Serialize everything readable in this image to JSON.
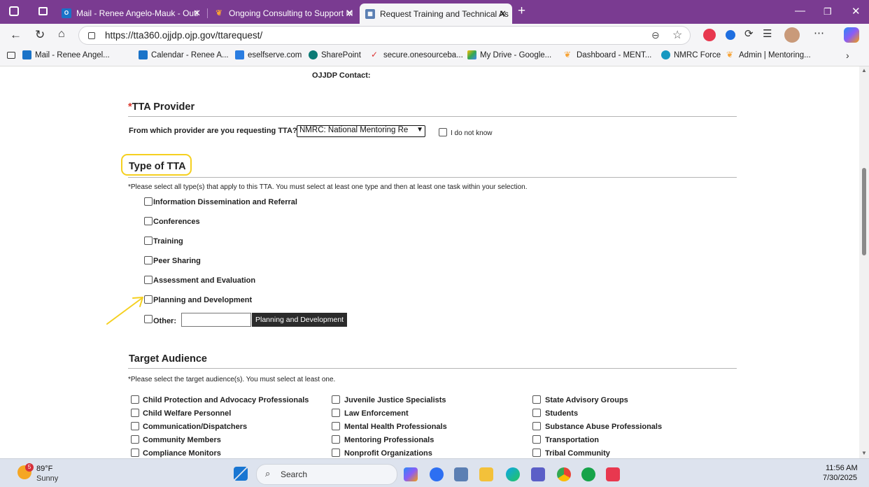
{
  "browser": {
    "tabs": [
      {
        "label": "Mail - Renee Angelo-Mauk - Outl",
        "active": false
      },
      {
        "label": "Ongoing Consulting to Support M",
        "active": false
      },
      {
        "label": "Request Training and Technical As",
        "active": true
      }
    ],
    "url": "https://tta360.ojjdp.ojp.gov/ttarequest/",
    "bookmarks": [
      "Mail - Renee Angel...",
      "Calendar - Renee A...",
      "eselfserve.com",
      "SharePoint",
      "secure.onesourceba...",
      "My Drive - Google...",
      "Dashboard - MENT...",
      "NMRC Force",
      "Admin | Mentoring..."
    ],
    "colors": {
      "titlebar": "#7a3b91",
      "toolbar": "#f5f5f7",
      "highlight": "#f5d020"
    }
  },
  "form": {
    "contact_label": "OJJDP Contact:",
    "provider": {
      "required_mark": "*",
      "title": "TTA Provider",
      "question": "From which provider are you requesting TTA?",
      "selected": "NMRC: National Mentoring Re",
      "dont_know": "I do not know"
    },
    "type_of_tta": {
      "title": "Type of TTA",
      "instruction": "*Please select all type(s) that apply to this TTA. You must select at least one type and then at least one task within your selection.",
      "options": [
        "Information Dissemination and Referral",
        "Conferences",
        "Training",
        "Peer Sharing",
        "Assessment and Evaluation",
        "Planning and Development"
      ],
      "other_label": "Other:",
      "tooltip": "Planning and Development"
    },
    "target_audience": {
      "title": "Target Audience",
      "instruction": "*Please select the target audience(s). You must select at least one.",
      "col1": [
        "Child Protection and Advocacy Professionals",
        "Child Welfare Personnel",
        "Communication/Dispatchers",
        "Community Members",
        "Compliance Monitors"
      ],
      "col2": [
        "Juvenile Justice Specialists",
        "Law Enforcement",
        "Mental Health Professionals",
        "Mentoring Professionals",
        "Nonprofit Organizations"
      ],
      "col3": [
        "State Advisory Groups",
        "Students",
        "Substance Abuse Professionals",
        "Transportation",
        "Tribal Community"
      ]
    }
  },
  "taskbar": {
    "weather_temp": "89°F",
    "weather_desc": "Sunny",
    "weather_badge": "5",
    "search_label": "Search",
    "time": "11:56 AM",
    "date": "7/30/2025"
  }
}
